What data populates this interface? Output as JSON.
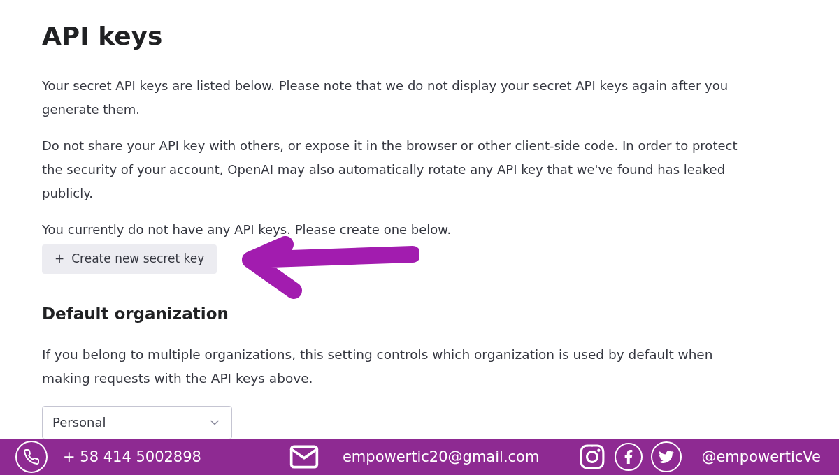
{
  "page": {
    "title": "API keys",
    "paragraphs": [
      "Your secret API keys are listed below. Please note that we do not display your secret API keys again after you generate them.",
      "Do not share your API key with others, or expose it in the browser or other client-side code. In order to protect the security of your account, OpenAI may also automatically rotate any API key that we've found has leaked publicly.",
      "You currently do not have any API keys. Please create one below."
    ],
    "create_button": {
      "icon": "+",
      "label": "Create new secret key"
    }
  },
  "default_organization": {
    "heading": "Default organization",
    "description": "If you belong to multiple organizations, this setting controls which organization is used by default when making requests with the API keys above.",
    "select": {
      "value": "Personal"
    }
  },
  "contact_bar": {
    "phone": "+ 58 414 5002898",
    "email": "empowertic20@gmail.com",
    "handle": "@empowerticVe"
  }
}
